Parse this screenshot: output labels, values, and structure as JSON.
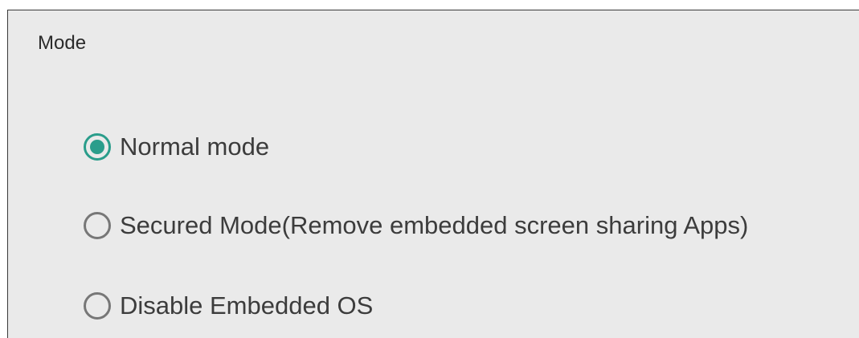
{
  "section": {
    "title": "Mode"
  },
  "options": [
    {
      "label": "Normal mode",
      "checked": true
    },
    {
      "label": "Secured Mode(Remove embedded screen sharing Apps)",
      "checked": false
    },
    {
      "label": "Disable Embedded OS",
      "checked": false
    }
  ],
  "colors": {
    "accent": "#2a9d8b",
    "radio_unchecked": "#777777",
    "panel_background": "#eaeaea"
  }
}
